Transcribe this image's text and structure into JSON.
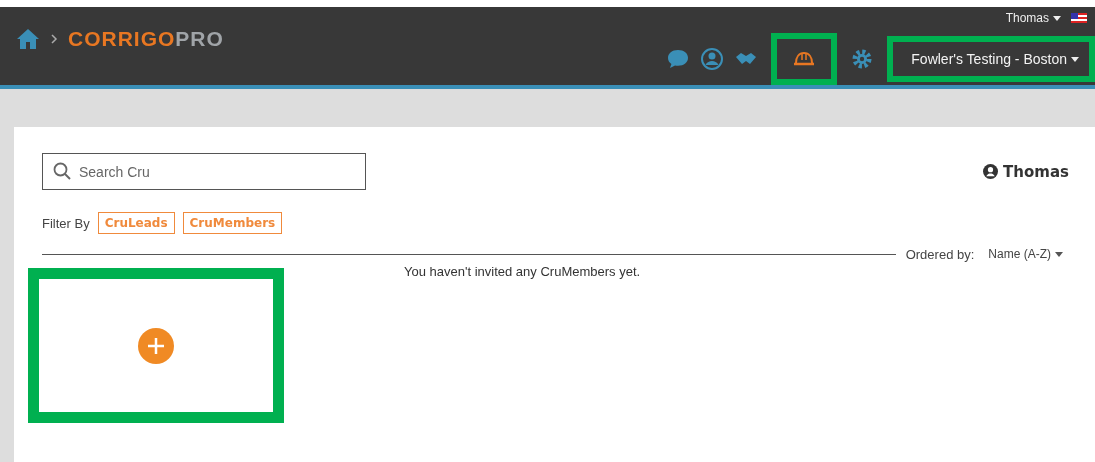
{
  "header": {
    "logo_primary": "CORRIGO",
    "logo_secondary": "PRO",
    "user_menu": "Thomas",
    "location": "Fowler's Testing - Boston"
  },
  "search": {
    "placeholder": "Search Cru"
  },
  "user_name": "Thomas",
  "filter": {
    "label": "Filter By",
    "chips": [
      "CruLeads",
      "CruMembers"
    ]
  },
  "order": {
    "label": "Ordered by:",
    "value": "Name (A-Z)"
  },
  "empty_message": "You haven't invited any CruMembers yet."
}
